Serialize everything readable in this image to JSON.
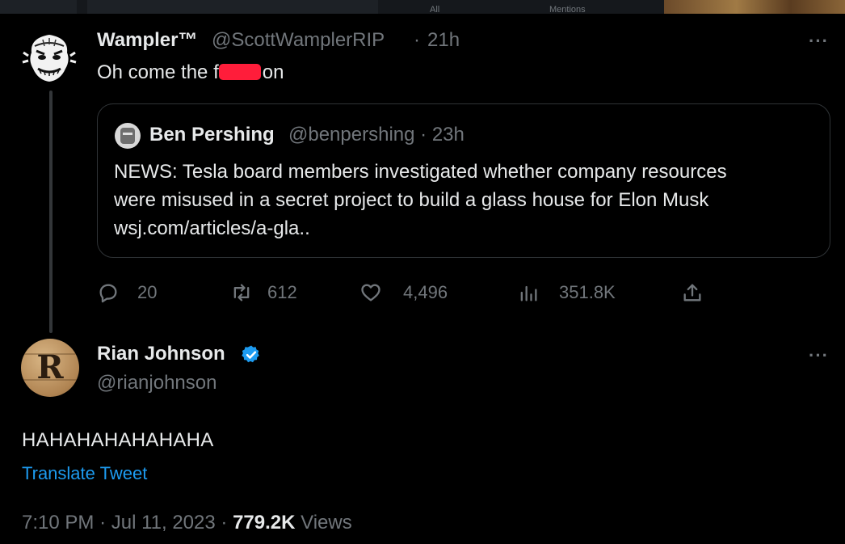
{
  "top_bar": {
    "tabs": [
      "All",
      "Mentions"
    ]
  },
  "parent_tweet": {
    "author_name": "Wampler™",
    "handle": "@ScottWamplerRIP",
    "separator": "·",
    "time": "21h",
    "text_before": "Oh come the f",
    "text_after": "on",
    "more_icon": "more-dots-icon",
    "quote": {
      "author_name": "Ben Pershing",
      "handle": "@benpershing",
      "separator": "·",
      "time": "23h",
      "lines": [
        "NEWS: Tesla board members investigated whether company resources",
        "were misused in a secret project to build a glass house for Elon Musk",
        "wsj.com/articles/a-gla.."
      ]
    },
    "actions": {
      "replies": "20",
      "retweets": "612",
      "likes": "4,496",
      "views": "351.8K"
    }
  },
  "main_tweet": {
    "author_name": "Rian Johnson",
    "handle": "@rianjohnson",
    "avatar_letter": "R",
    "text": "HAHAHAHAHAHAHA",
    "translate_label": "Translate Tweet",
    "footer": {
      "time": "7:10 PM",
      "separator": "·",
      "date": "Jul 11, 2023",
      "views_count": "779.2K",
      "views_label": "Views"
    }
  },
  "colors": {
    "background": "#000000",
    "text": "#e7e9ea",
    "muted": "#71767b",
    "link": "#1d9bf0",
    "redaction": "#ff1d3a",
    "verified": "#1d9bf0"
  }
}
